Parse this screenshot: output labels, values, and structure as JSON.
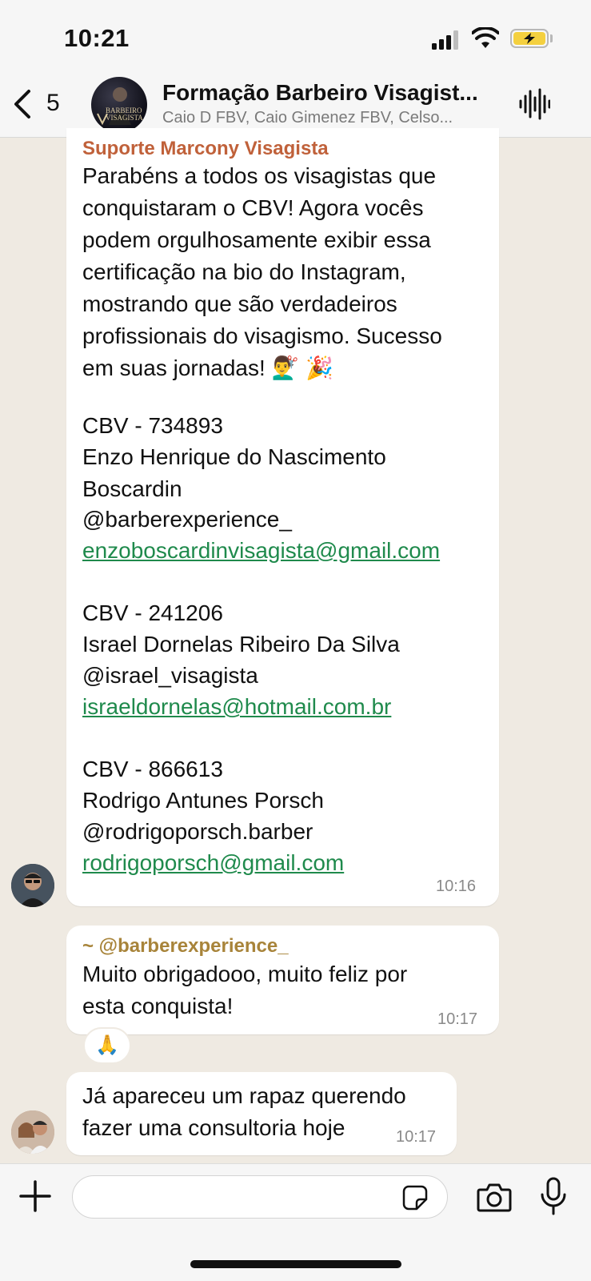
{
  "status_bar": {
    "time": "10:21"
  },
  "header": {
    "back_count": "5",
    "title": "Formação Barbeiro Visagist...",
    "members": "Caio D FBV, Caio Gimenez FBV, Celso...",
    "avatar_text_1": "BARBEIRO",
    "avatar_text_2": "VISAGISTA"
  },
  "colors": {
    "sender1": "#c0613a",
    "sender2": "#a8843a",
    "link": "#1f8a4c",
    "chat_background": "#efeae2"
  },
  "messages": [
    {
      "sender": "Suporte Marcony Visagista",
      "intro": "Parabéns a todos os visagistas que\nconquistaram o CBV! Agora vocês\npodem orgulhosamente exibir essa\ncertificação na bio do Instagram,\nmostrando que são verdadeiros\nprofissionais do visagismo. Sucesso\nem suas jornadas! 💇‍♂️ 🎉",
      "entries": [
        {
          "code": "CBV - 734893",
          "name": "Enzo Henrique do Nascimento\nBoscardin",
          "handle": "@barberexperience_",
          "email": "enzoboscardinvisagista@gmail.com"
        },
        {
          "code": "CBV - 241206",
          "name": "Israel Dornelas Ribeiro Da Silva",
          "handle": "@israel_visagista",
          "email": "israeldornelas@hotmail.com.br"
        },
        {
          "code": "CBV - 866613",
          "name": "Rodrigo Antunes Porsch",
          "handle": "@rodrigoporsch.barber",
          "email": "rodrigoporsch@gmail.com"
        }
      ],
      "time": "10:16"
    },
    {
      "sender": "~ @barberexperience_",
      "text": "Muito obrigadooo, muito feliz por\nesta conquista!",
      "time": "10:17",
      "reaction": "🙏"
    },
    {
      "text": "Já apareceu um rapaz querendo\nfazer uma consultoria hoje",
      "time": "10:17"
    }
  ],
  "composer": {
    "placeholder": ""
  }
}
